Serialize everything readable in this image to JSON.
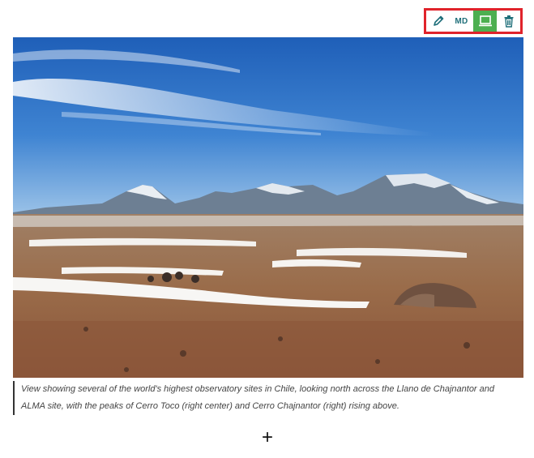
{
  "toolbar": {
    "edit_icon": "pencil-icon",
    "md_label": "MD",
    "preview_icon": "laptop-icon",
    "delete_icon": "trash-icon",
    "highlight_color": "#e0232b",
    "active_color": "#4caf50"
  },
  "image": {
    "subject": "landscape-photo"
  },
  "caption": {
    "text": "View showing several of the world's highest observatory sites in Chile, looking north across the Llano de Chajnantor and ALMA site, with the peaks of Cerro Toco (right center) and Cerro Chajnantor (right) rising above."
  },
  "add_block": {
    "label": "+"
  }
}
